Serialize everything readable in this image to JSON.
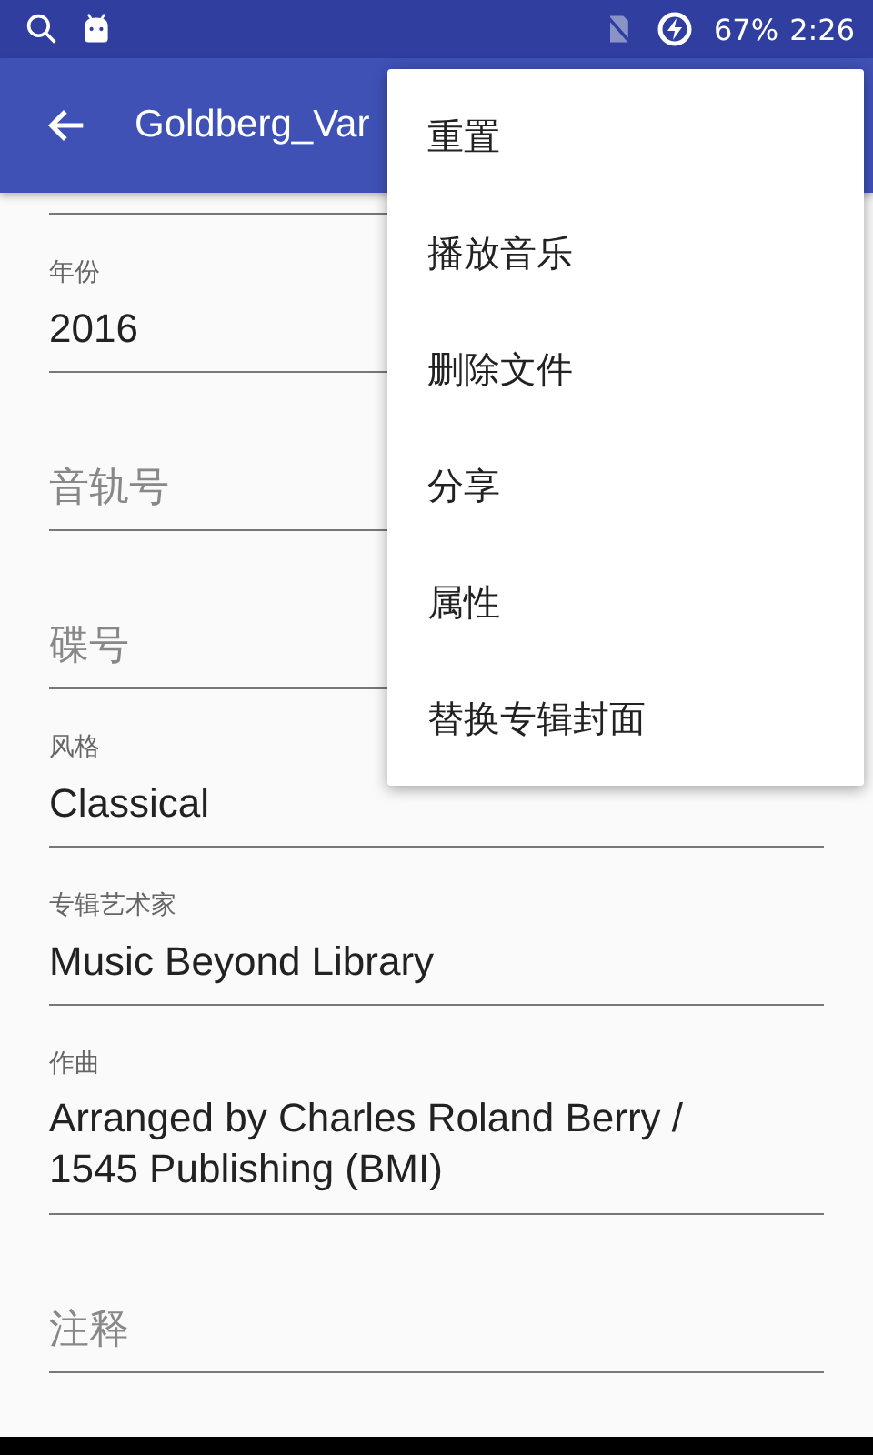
{
  "status_bar": {
    "battery": "67%",
    "time": "2:26"
  },
  "app_bar": {
    "title": "Goldberg_Var"
  },
  "fields": [
    {
      "label": "年份",
      "value": "2016"
    },
    {
      "placeholder": "音轨号"
    },
    {
      "placeholder": "碟号"
    },
    {
      "label": "风格",
      "value": "Classical"
    },
    {
      "label": "专辑艺术家",
      "value": "Music Beyond Library"
    },
    {
      "label": "作曲",
      "value": "Arranged by Charles Roland Berry / 1545 Publishing (BMI)",
      "multiline": true
    },
    {
      "placeholder": "注释"
    }
  ],
  "menu": [
    "重置",
    "播放音乐",
    "删除文件",
    "分享",
    "属性",
    "替换专辑封面"
  ]
}
